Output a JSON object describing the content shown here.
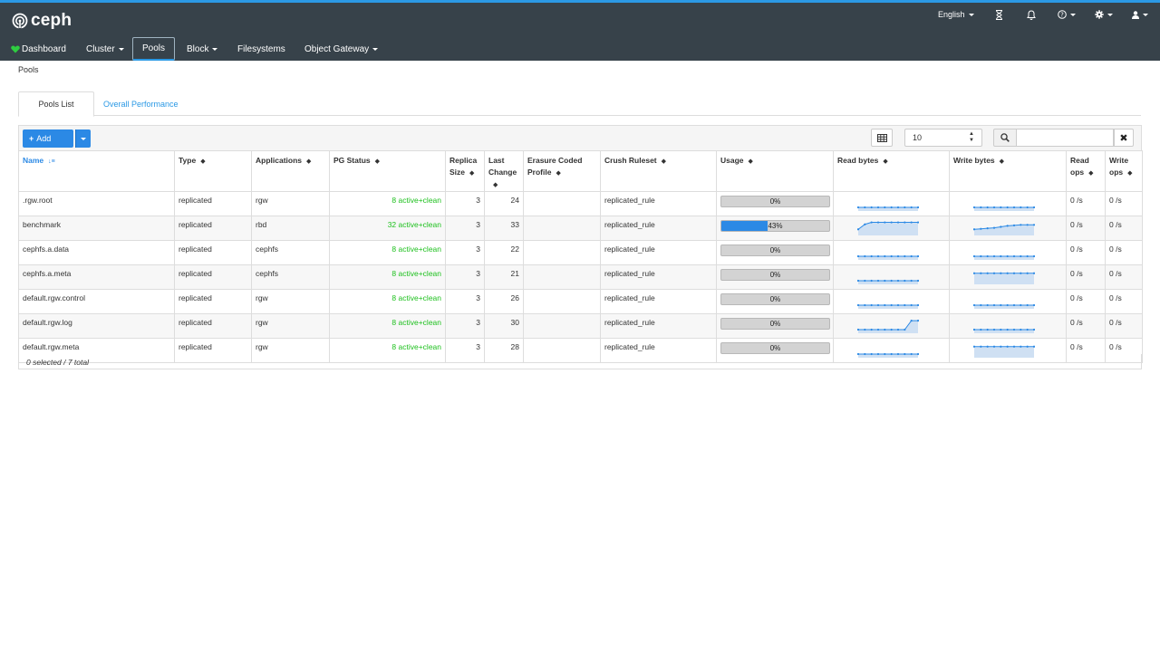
{
  "app": {
    "logo_text": "ceph"
  },
  "utility": {
    "language": "English"
  },
  "nav": [
    {
      "label": "Dashboard",
      "dropdown": false
    },
    {
      "label": "Cluster",
      "dropdown": true
    },
    {
      "label": "Pools",
      "dropdown": false,
      "active": true
    },
    {
      "label": "Block",
      "dropdown": true
    },
    {
      "label": "Filesystems",
      "dropdown": false
    },
    {
      "label": "Object Gateway",
      "dropdown": true
    }
  ],
  "breadcrumb": "Pools",
  "tabs": [
    {
      "label": "Pools List",
      "active": true
    },
    {
      "label": "Overall Performance",
      "active": false
    }
  ],
  "toolbar": {
    "add_label": "Add",
    "page_limit": "10",
    "search_value": ""
  },
  "table": {
    "headers": {
      "name": "Name",
      "type": "Type",
      "applications": "Applications",
      "pg_status": "PG Status",
      "replica_1": "Replica",
      "replica_2": "Size",
      "last_1": "Last",
      "last_2": "Change",
      "erasure_1": "Erasure Coded",
      "erasure_2": "Profile",
      "crush": "Crush Ruleset",
      "usage": "Usage",
      "read_bytes": "Read bytes",
      "write_bytes": "Write bytes",
      "read_ops_1": "Read",
      "read_ops_2": "ops",
      "write_ops_1": "Write",
      "write_ops_2": "ops"
    },
    "rows": [
      {
        "name": ".rgw.root",
        "type": "replicated",
        "app": "rgw",
        "pg": "8 active+clean",
        "size": "3",
        "change": "24",
        "ec": "",
        "crush": "replicated_rule",
        "usage": "0%",
        "usage_value": 0,
        "read_trend": "flat",
        "write_trend": "flat",
        "read_ops": "0 /s",
        "write_ops": "0 /s"
      },
      {
        "name": "benchmark",
        "type": "replicated",
        "app": "rbd",
        "pg": "32 active+clean",
        "size": "3",
        "change": "33",
        "ec": "",
        "crush": "replicated_rule",
        "usage": "43%",
        "usage_value": 43,
        "read_trend": "rise-early",
        "write_trend": "slow-rise",
        "read_ops": "0 /s",
        "write_ops": "0 /s"
      },
      {
        "name": "cephfs.a.data",
        "type": "replicated",
        "app": "cephfs",
        "pg": "8 active+clean",
        "size": "3",
        "change": "22",
        "ec": "",
        "crush": "replicated_rule",
        "usage": "0%",
        "usage_value": 0,
        "read_trend": "flat",
        "write_trend": "flat",
        "read_ops": "0 /s",
        "write_ops": "0 /s"
      },
      {
        "name": "cephfs.a.meta",
        "type": "replicated",
        "app": "cephfs",
        "pg": "8 active+clean",
        "size": "3",
        "change": "21",
        "ec": "",
        "crush": "replicated_rule",
        "usage": "0%",
        "usage_value": 0,
        "read_trend": "flat",
        "write_trend": "high",
        "read_ops": "0 /s",
        "write_ops": "0 /s"
      },
      {
        "name": "default.rgw.control",
        "type": "replicated",
        "app": "rgw",
        "pg": "8 active+clean",
        "size": "3",
        "change": "26",
        "ec": "",
        "crush": "replicated_rule",
        "usage": "0%",
        "usage_value": 0,
        "read_trend": "flat",
        "write_trend": "flat",
        "read_ops": "0 /s",
        "write_ops": "0 /s"
      },
      {
        "name": "default.rgw.log",
        "type": "replicated",
        "app": "rgw",
        "pg": "8 active+clean",
        "size": "3",
        "change": "30",
        "ec": "",
        "crush": "replicated_rule",
        "usage": "0%",
        "usage_value": 0,
        "read_trend": "rise-late",
        "write_trend": "flat",
        "read_ops": "0 /s",
        "write_ops": "0 /s"
      },
      {
        "name": "default.rgw.meta",
        "type": "replicated",
        "app": "rgw",
        "pg": "8 active+clean",
        "size": "3",
        "change": "28",
        "ec": "",
        "crush": "replicated_rule",
        "usage": "0%",
        "usage_value": 0,
        "read_trend": "flat",
        "write_trend": "high",
        "read_ops": "0 /s",
        "write_ops": "0 /s"
      }
    ]
  },
  "footer": "0 selected / 7 total",
  "colors": {
    "accent": "#2b89e5",
    "topbar": "#37424a",
    "pg_ok": "#1ec01e"
  }
}
